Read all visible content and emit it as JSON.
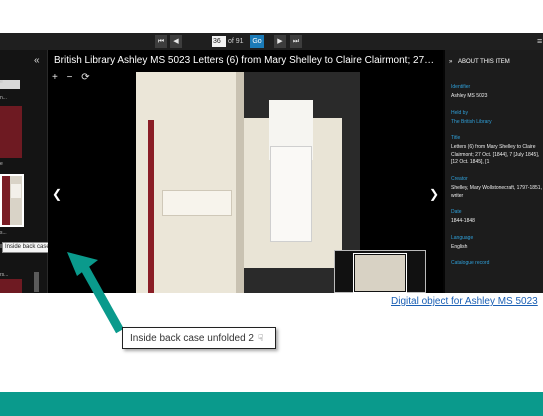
{
  "toolbar": {
    "first_icon": "first-page-icon",
    "prev_icon": "previous-page-icon",
    "page_value": "36",
    "page_of": "of 91",
    "go_label": "Go",
    "next_icon": "next-page-icon",
    "last_icon": "last-page-icon"
  },
  "thumbnails": {
    "collapse_icon": "double-chevron-left-icon",
    "items": [
      "e",
      "n...",
      "e",
      "s...",
      "rs...",
      "e"
    ]
  },
  "viewer": {
    "title": "British Library Ashley MS 5023 Letters (6) from Mary Shelley to Claire Clairmont; 27…",
    "zoom_in": "+",
    "zoom_out": "−",
    "tooltip": "Inside back case unfolded 2"
  },
  "info_panel": {
    "heading": "ABOUT THIS ITEM",
    "fields": [
      {
        "label": "Identifier",
        "value": "Ashley MS 5023"
      },
      {
        "label": "Held by",
        "value": "The British Library"
      },
      {
        "label": "Title",
        "value": "Letters (6) from Mary Shelley to Claire Clairmont; 27 Oct. [1844], 7 [July 1845], [12 Oct. 1845], [1"
      },
      {
        "label": "Creator",
        "value": "Shelley, Mary Wollstonecraft, 1797-1851, writer"
      },
      {
        "label": "Date",
        "value": "1844-1848"
      },
      {
        "label": "Language",
        "value": "English"
      },
      {
        "label": "Catalogue record",
        "value": ""
      }
    ]
  },
  "caption": {
    "link_text": "Digital object for Ashley MS 5023",
    "callout_text": "Inside back case unfolded 2"
  },
  "colors": {
    "arrow": "#0a9a8c",
    "band": "#0a9a8c",
    "go_button": "#1b7bb8",
    "accent_label": "#2f9fd8"
  }
}
